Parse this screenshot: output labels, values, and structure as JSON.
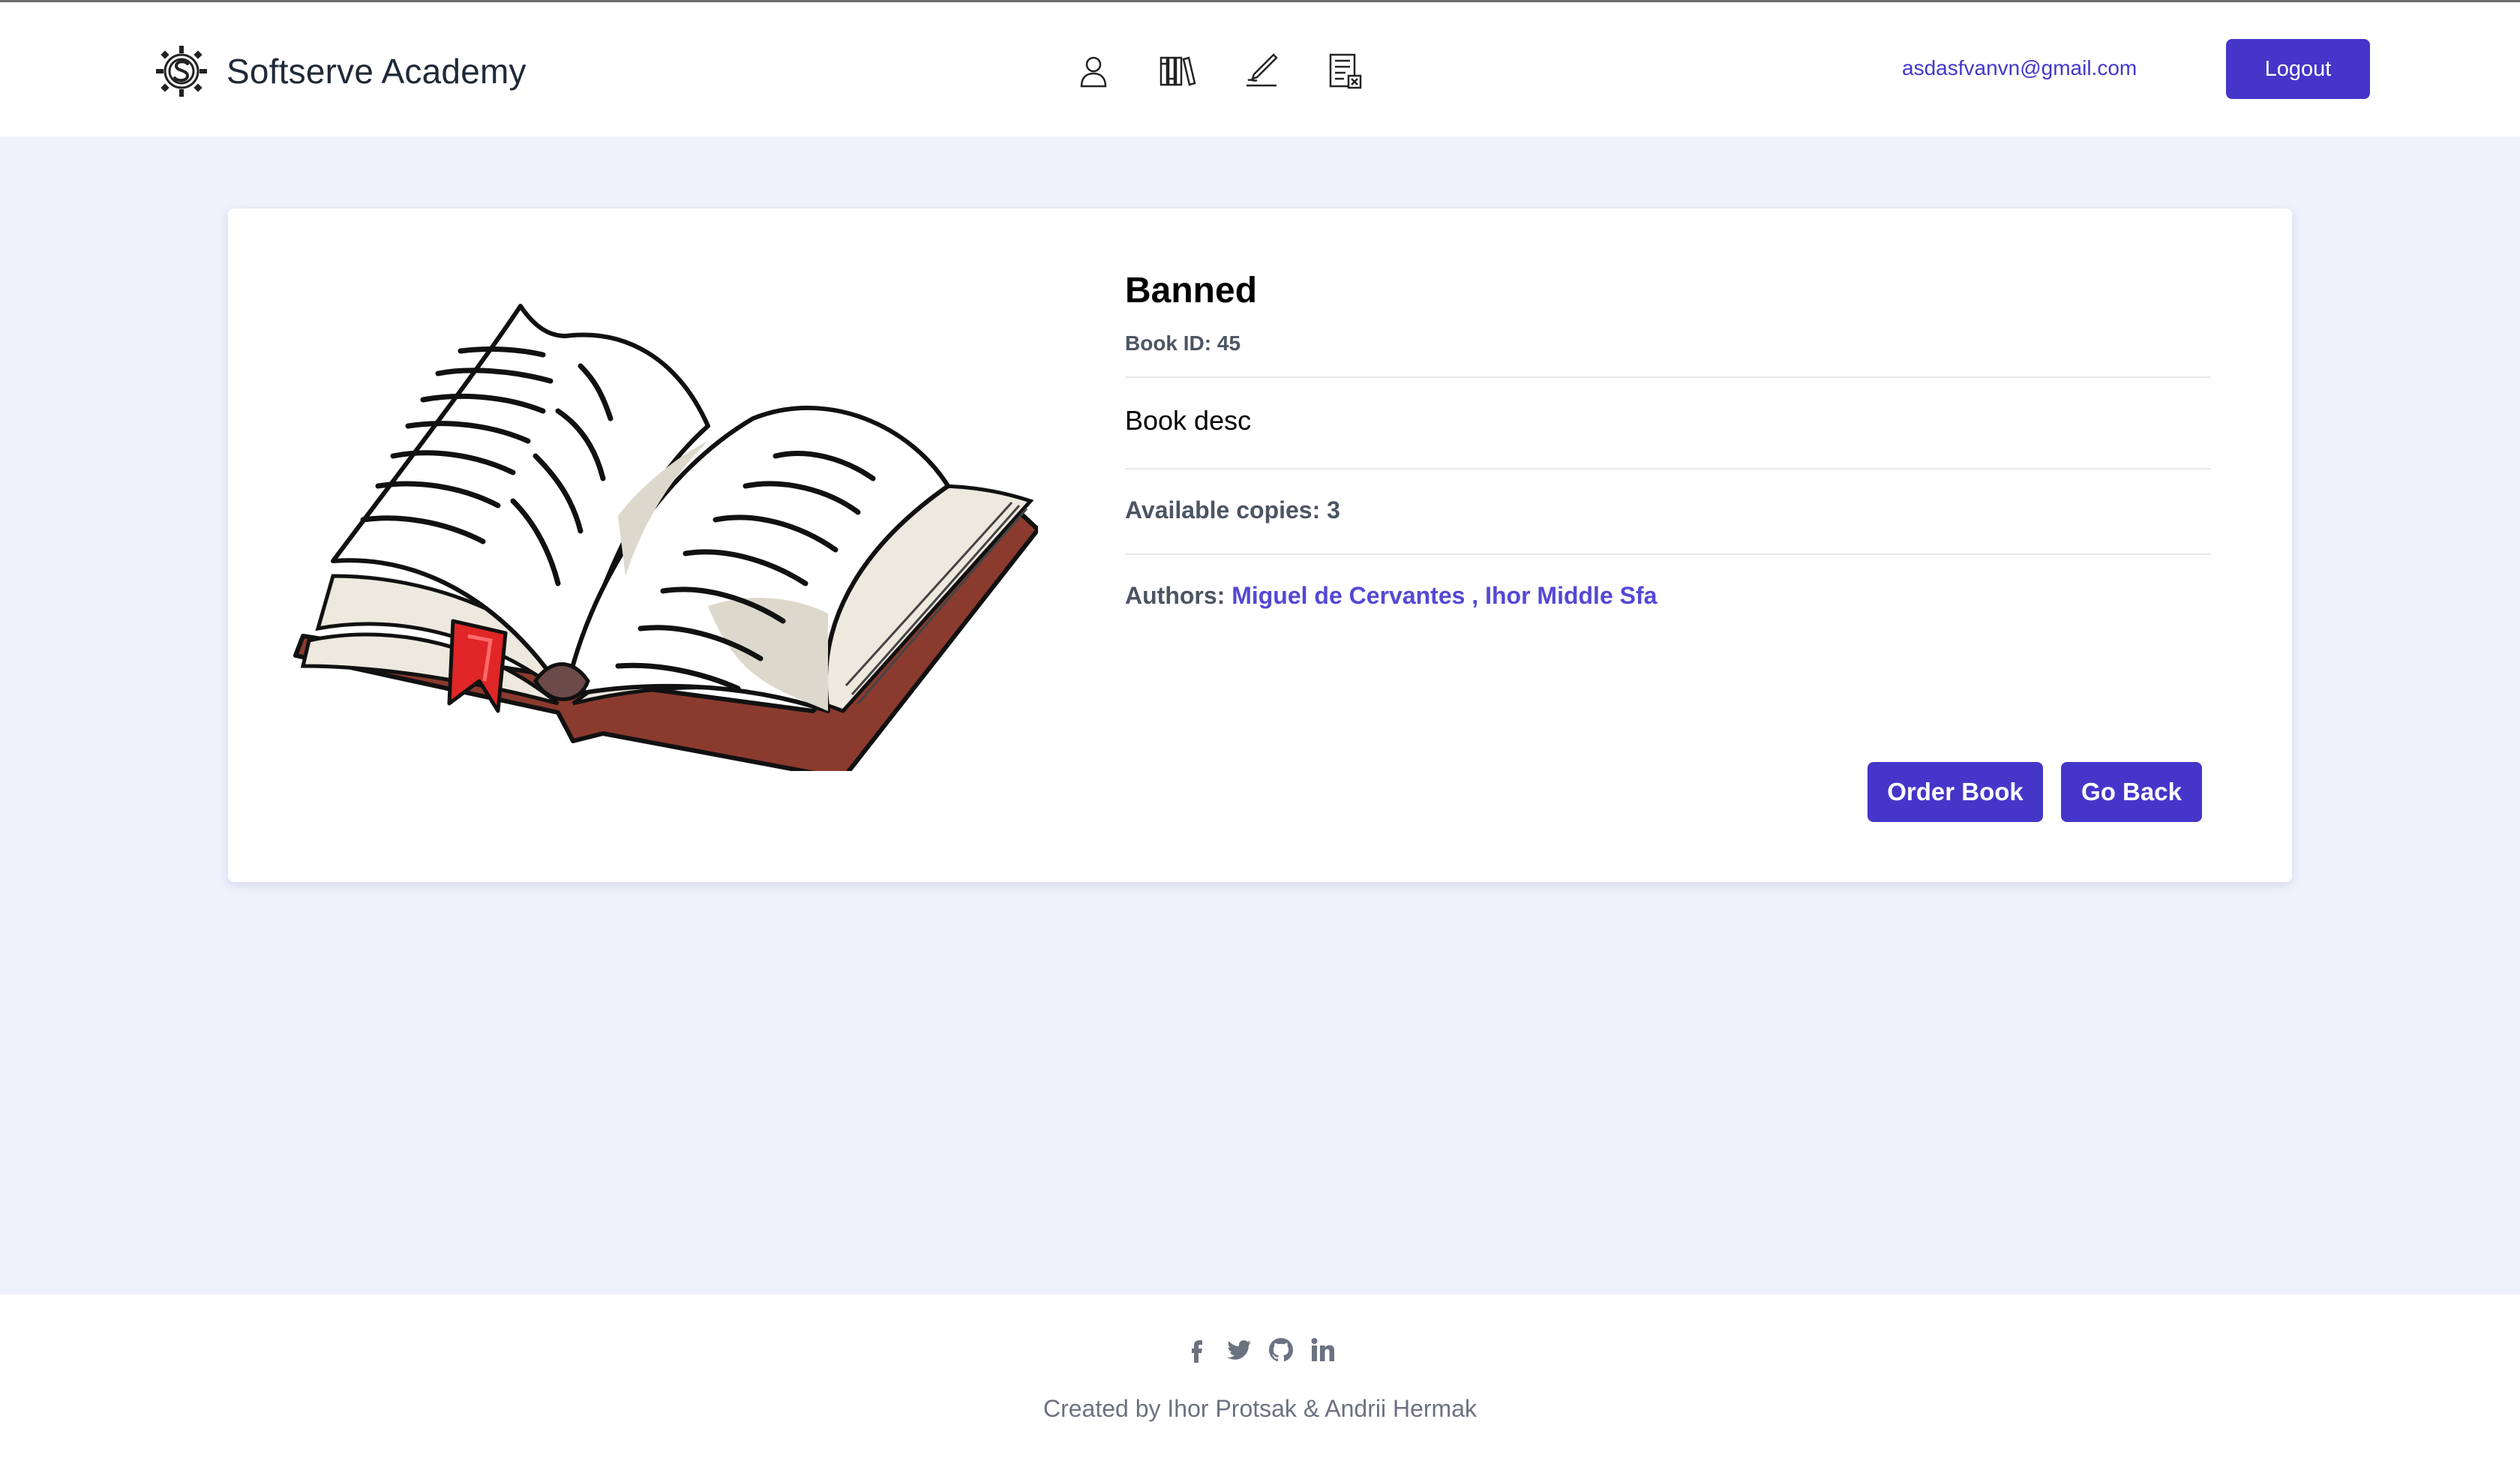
{
  "header": {
    "brand_name": "Softserve Academy",
    "nav_icons": [
      "user-icon",
      "library-icon",
      "pen-icon",
      "order-list-icon"
    ],
    "user_email": "asdasfvanvn@gmail.com",
    "logout_label": "Logout"
  },
  "book": {
    "title": "Banned",
    "id_text": "Book ID: 45",
    "description": "Book desc",
    "copies_label": "Available copies:",
    "copies_value": "3",
    "authors_label": "Authors:",
    "authors": [
      "Miguel de Cervantes ,",
      "Ihor Middle Sfa"
    ],
    "order_label": "Order Book",
    "back_label": "Go Back"
  },
  "footer": {
    "social_icons": [
      "facebook-icon",
      "twitter-icon",
      "github-icon",
      "linkedin-icon"
    ],
    "credits": "Created by Ihor Protsak & Andrii Hermak"
  },
  "colors": {
    "accent": "#4536c9",
    "link": "#5448d6",
    "page_bg": "#eef2fd"
  }
}
